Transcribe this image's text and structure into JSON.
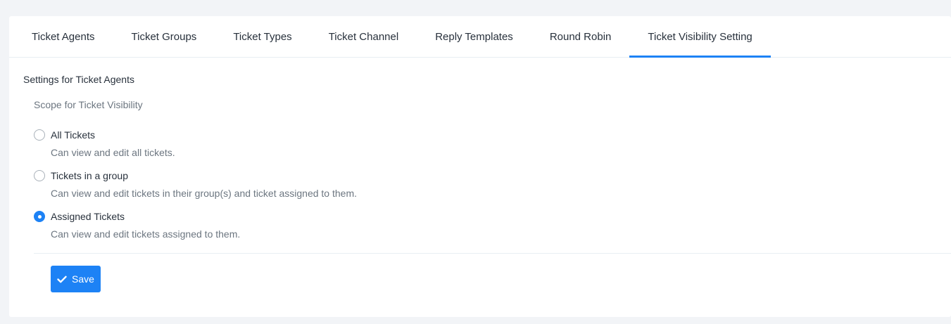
{
  "tabs": [
    {
      "label": "Ticket Agents",
      "active": false
    },
    {
      "label": "Ticket Groups",
      "active": false
    },
    {
      "label": "Ticket Types",
      "active": false
    },
    {
      "label": "Ticket Channel",
      "active": false
    },
    {
      "label": "Reply Templates",
      "active": false
    },
    {
      "label": "Round Robin",
      "active": false
    },
    {
      "label": "Ticket Visibility Setting",
      "active": true
    }
  ],
  "settings": {
    "title": "Settings for Ticket Agents",
    "scope_label": "Scope for Ticket Visibility",
    "options": [
      {
        "label": "All Tickets",
        "description": "Can view and edit all tickets.",
        "checked": false
      },
      {
        "label": "Tickets in a group",
        "description": "Can view and edit tickets in their group(s) and ticket assigned to them.",
        "checked": false
      },
      {
        "label": "Assigned Tickets",
        "description": "Can view and edit tickets assigned to them.",
        "checked": true
      }
    ]
  },
  "actions": {
    "save_label": "Save",
    "save_icon": "check-icon"
  },
  "colors": {
    "accent": "#1d82f5",
    "background": "#f2f4f7",
    "text": "#28313c",
    "muted_text": "#6c7680"
  }
}
